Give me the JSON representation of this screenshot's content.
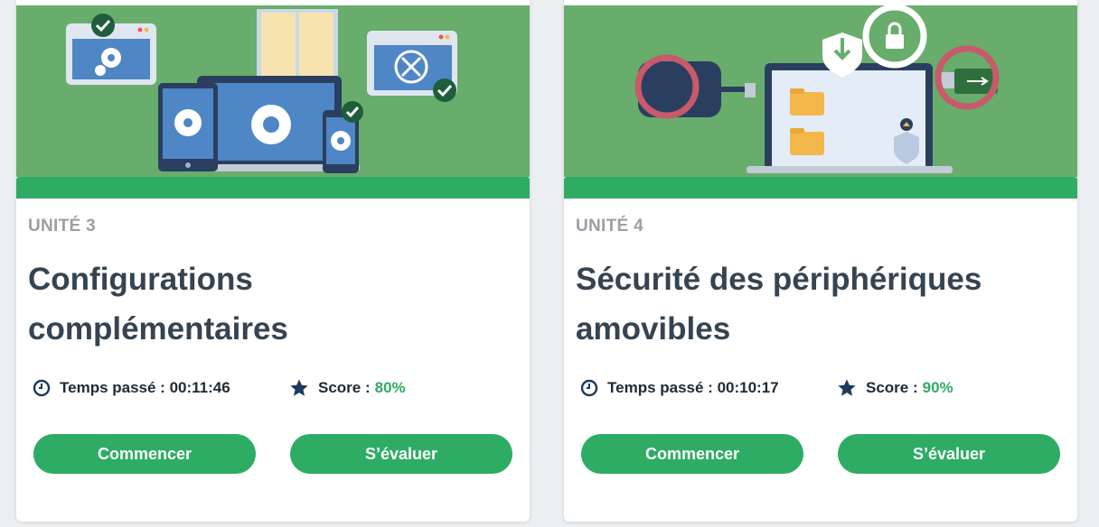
{
  "colors": {
    "accent": "#2eac64",
    "illustration_bg": "#68ad6c",
    "title": "#354451",
    "unit": "#9a9fa5",
    "icon": "#1b3a5c"
  },
  "cards": [
    {
      "unit_label": "UNITÉ 3",
      "title": "Configurations complémentaires",
      "time_label": "Temps passé : 00:11:46",
      "score_label": "Score :",
      "score_value": "80%",
      "start_label": "Commencer",
      "eval_label": "S’évaluer",
      "illustration": "devices-settings-illustration"
    },
    {
      "unit_label": "UNITÉ 4",
      "title": "Sécurité des périphériques amovibles",
      "time_label": "Temps passé : 00:10:17",
      "score_label": "Score :",
      "score_value": "90%",
      "start_label": "Commencer",
      "eval_label": "S’évaluer",
      "illustration": "removable-devices-illustration"
    }
  ]
}
